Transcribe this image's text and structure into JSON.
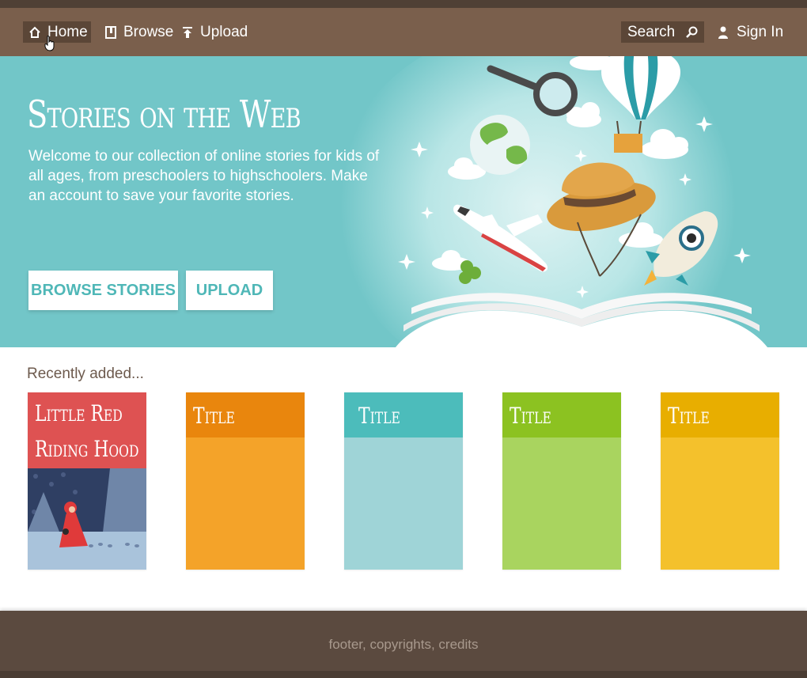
{
  "nav": {
    "home_label": "Home",
    "browse_label": "Browse",
    "upload_label": "Upload",
    "search_label": "Search",
    "signin_label": "Sign In"
  },
  "hero": {
    "title": "Stories on the Web",
    "description": "Welcome to our collection of online stories for kids of all ages, from preschoolers to highschoolers. Make an account to save your favorite stories.",
    "browse_button": "BROWSE STORIES",
    "upload_button": "UPLOAD"
  },
  "recent": {
    "label": "Recently added...",
    "cards": [
      {
        "title_line1": "Little Red",
        "title_line2": "Riding Hood"
      },
      {
        "title": "Title"
      },
      {
        "title": "Title"
      },
      {
        "title": "Title"
      },
      {
        "title": "Title"
      }
    ]
  },
  "footer": {
    "text": "footer, copyrights, credits"
  },
  "colors": {
    "nav_bg": "#7a5f4c",
    "hero_bg": "#72c6c8",
    "accent_text": "#4fb7b7",
    "footer_bg": "#5b4a3f"
  },
  "icons": [
    "home-icon",
    "book-icon",
    "upload-icon",
    "search-icon",
    "user-icon",
    "hand-cursor-icon"
  ]
}
